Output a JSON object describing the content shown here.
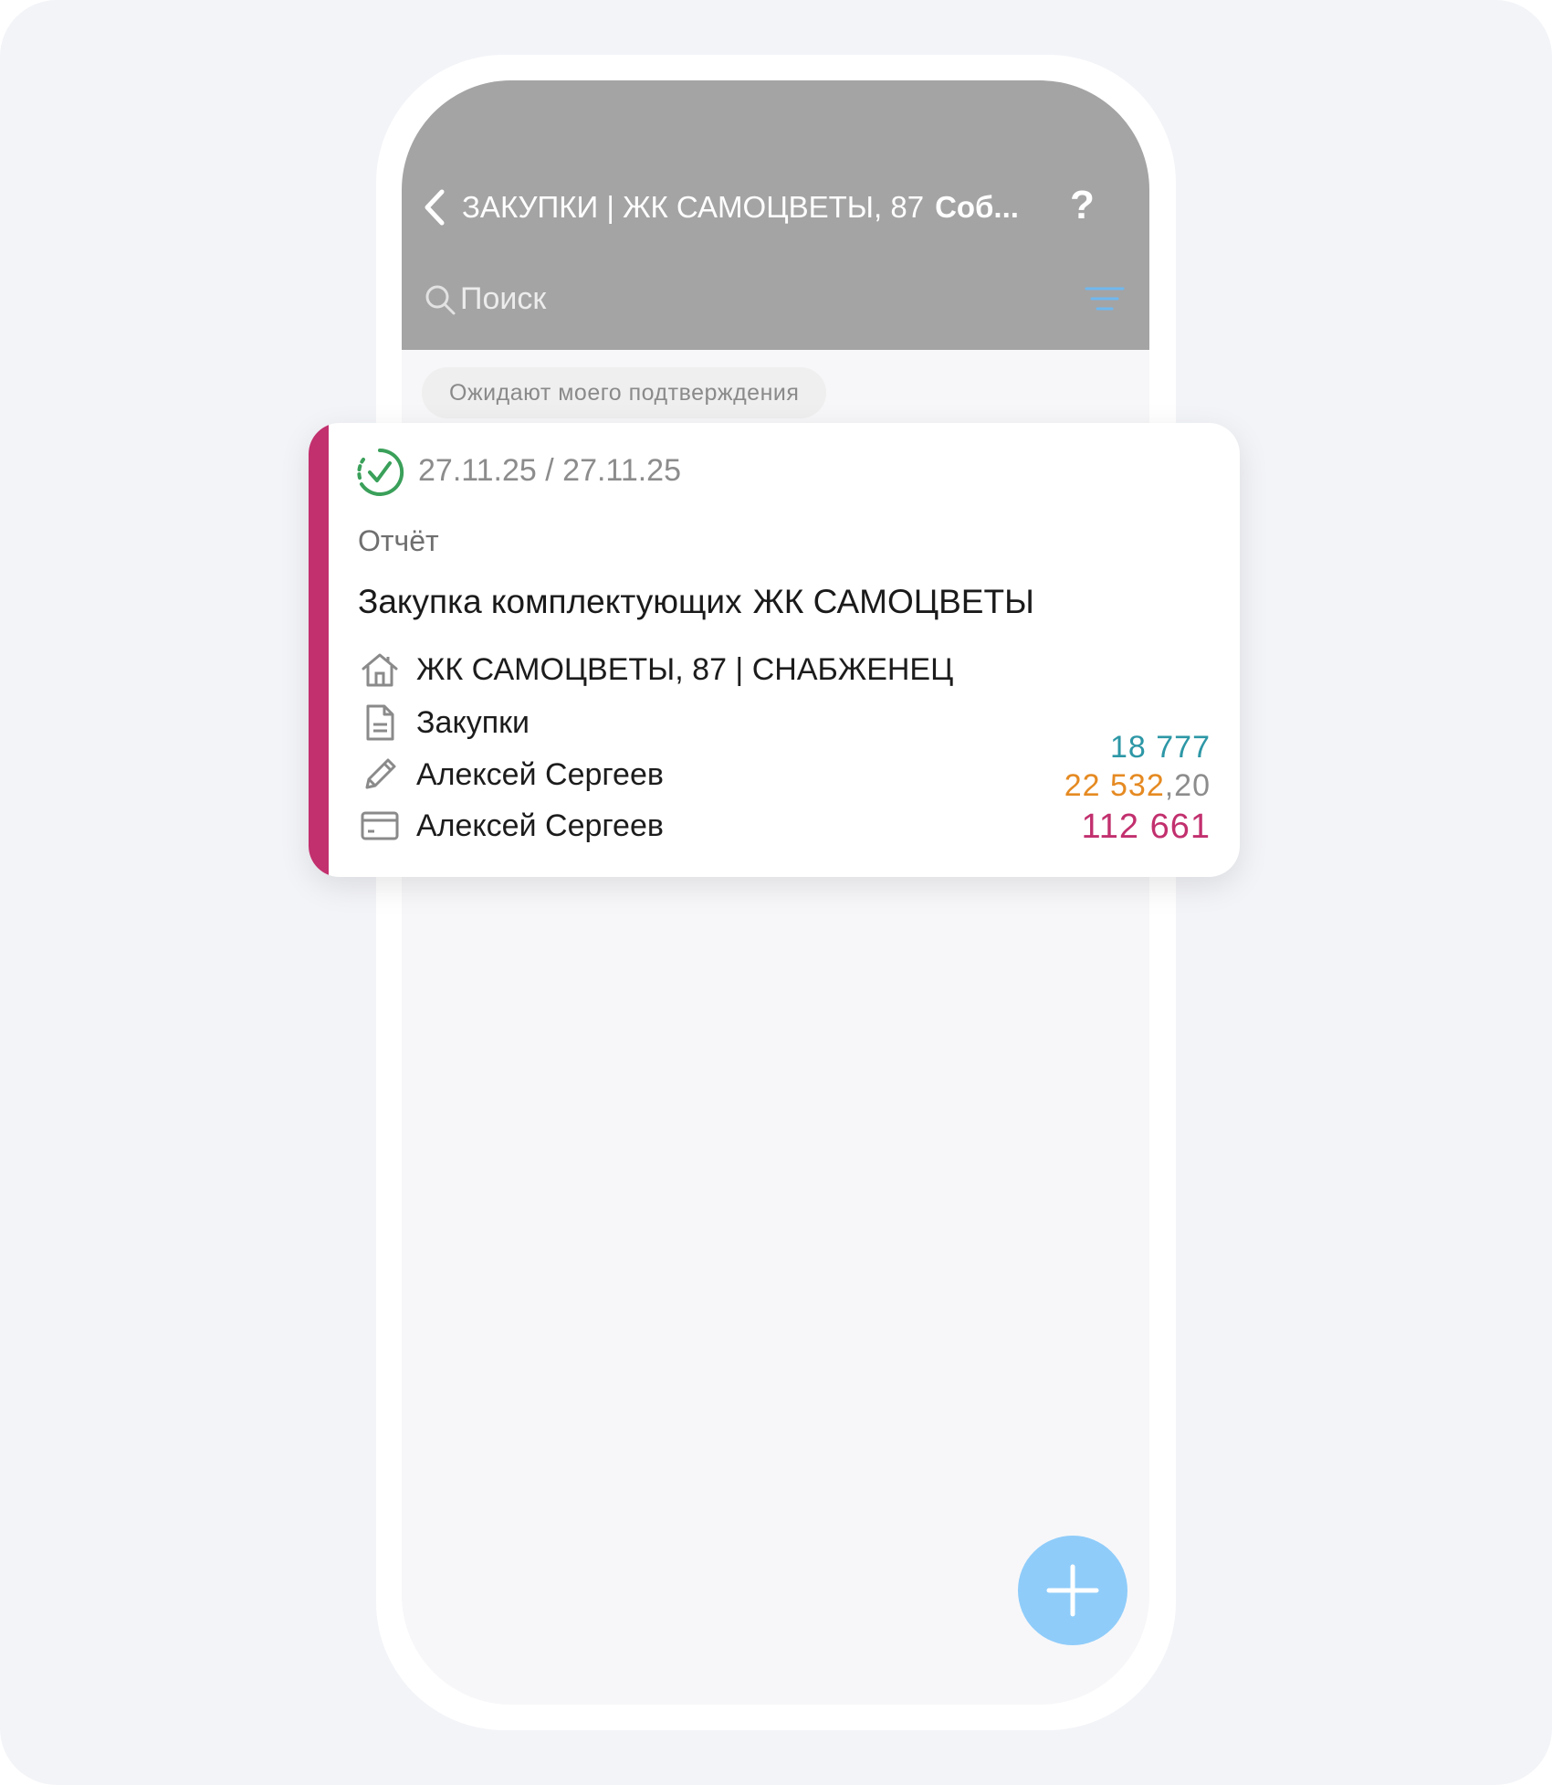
{
  "header": {
    "title_main": "ЗАКУПКИ | ЖК САМОЦВЕТЫ, 87",
    "title_bold": "Соб...",
    "help_label": "?"
  },
  "search": {
    "placeholder": "Поиск"
  },
  "filter_chip": {
    "label": "Ожидают моего подтверждения"
  },
  "card": {
    "accent_color": "#c2306e",
    "status_icon": "check-circle-icon",
    "dates": "27.11.25 / 27.11.25",
    "type": "Отчёт",
    "title_part1": "Закупка комплектующих",
    "title_part2": "ЖК САМОЦВЕТЫ",
    "rows": [
      {
        "icon": "home-icon",
        "text": "ЖК САМОЦВЕТЫ, 87 | СНАБЖЕНЕЦ"
      },
      {
        "icon": "document-icon",
        "text": "Закупки"
      },
      {
        "icon": "pencil-icon",
        "text": "Алексей Сергеев"
      },
      {
        "icon": "card-icon",
        "text": "Алексей Сергеев"
      }
    ],
    "amounts": {
      "first": "18 777",
      "second_int": "22 532",
      "second_dec": ",20",
      "third": "112 661"
    }
  },
  "fab": {
    "icon": "plus-icon"
  },
  "colors": {
    "header_bg": "#a4a4a4",
    "amount_teal": "#2d97a6",
    "amount_orange": "#e58a22",
    "amount_magenta": "#c2306e",
    "fab_bg": "#8fccfa",
    "filter_icon": "#6fb8ef"
  }
}
